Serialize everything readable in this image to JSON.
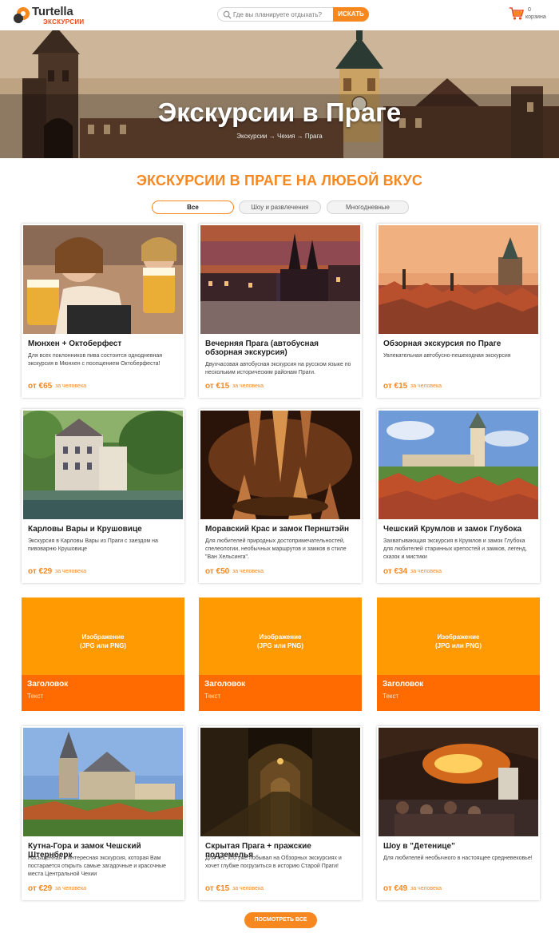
{
  "header": {
    "brand": "Turtella",
    "brand_sub": "ЭКСКУРСИИ",
    "search_placeholder": "Где вы планируете отдыхать?",
    "search_button": "ИСКАТЬ",
    "cart_count": "0",
    "cart_label": "корзина"
  },
  "hero": {
    "title": "Экскурсии в Праге",
    "breadcrumb": [
      "Экскурсии",
      "Чехия",
      "Прага"
    ],
    "breadcrumb_sep": "→"
  },
  "section": {
    "title": "ЭКСКУРСИИ В ПРАГЕ НА ЛЮБОЙ ВКУС",
    "filters": [
      "Все",
      "Шоу и развлечения",
      "Многодневные"
    ],
    "active_filter": "Все"
  },
  "cards": [
    {
      "title": "Мюнхен + Октоберфест",
      "desc": "Для всех поклонников пива состоится однодневная экскурсия в Мюнхен с посещением Октоберфеста!",
      "price": "от €65",
      "per": "за человека"
    },
    {
      "title": "Вечерняя Прага (автобусная обзорная экскурсия)",
      "desc": "Двухчасовая автобусная экскурсия на русском языке по нескольким историческим районам Праги.",
      "price": "от €15",
      "per": "за человека"
    },
    {
      "title": "Обзорная экскурсия по Праге",
      "desc": "Увлекательная автобусно-пешеходная экскурсия",
      "price": "от €15",
      "per": "за человека"
    },
    {
      "title": "Карловы Вары и Крушовице",
      "desc": "Экскурсия в Карловы Вары из Праги с заездом на пивоварню Крушовице",
      "price": "от €29",
      "per": "за человека"
    },
    {
      "title": "Моравский Крас и замок Пернштэйн",
      "desc": "Для любителей природных достопримечательностей, спелеологии, необычных маршрутов и замков в стиле \"Ван Хельсинга\".",
      "price": "от €50",
      "per": "за человека"
    },
    {
      "title": "Чешский Крумлов и замок Глубока",
      "desc": "Захватывающая экскурсия в Крумлов и замок Глубока для любителей старинных крепостей и замков, легенд, сказок и мистики",
      "price": "от €34",
      "per": "за человека"
    },
    {
      "title": "Кутна-Гора и замок Чешский Штернберк",
      "desc": "Насыщенная и интересная экскурсия, которая Вам постарается открыть самые загадочные и красочные места Центральной Чехии",
      "price": "от €29",
      "per": "за человека"
    },
    {
      "title": "Скрытая Прага + пражские подземелья",
      "desc": "Для тех, кто уже побывал на Обзорных экскурсиях и хочет глубже погрузиться в историю Старой Праги!",
      "price": "от €15",
      "per": "за человека"
    },
    {
      "title": "Шоу в \"Детенице\"",
      "desc": "Для любителей необычного в настоящее средневековье!",
      "price": "от €49",
      "per": "за человека"
    }
  ],
  "placeholders": [
    {
      "image_text": "Изображение\n(JPG или PNG)",
      "heading": "Заголовок",
      "text": "Текст"
    },
    {
      "image_text": "Изображение\n(JPG или PNG)",
      "heading": "Заголовок",
      "text": "Текст"
    },
    {
      "image_text": "Изображение\n(JPG или PNG)",
      "heading": "Заголовок",
      "text": "Текст"
    }
  ],
  "more_button": "ПОСМОТРЕТЬ ВСЕ",
  "colors": {
    "accent": "#f7871f",
    "placeholder": "#ff9a03",
    "placeholder_bar": "#ff6b00"
  }
}
